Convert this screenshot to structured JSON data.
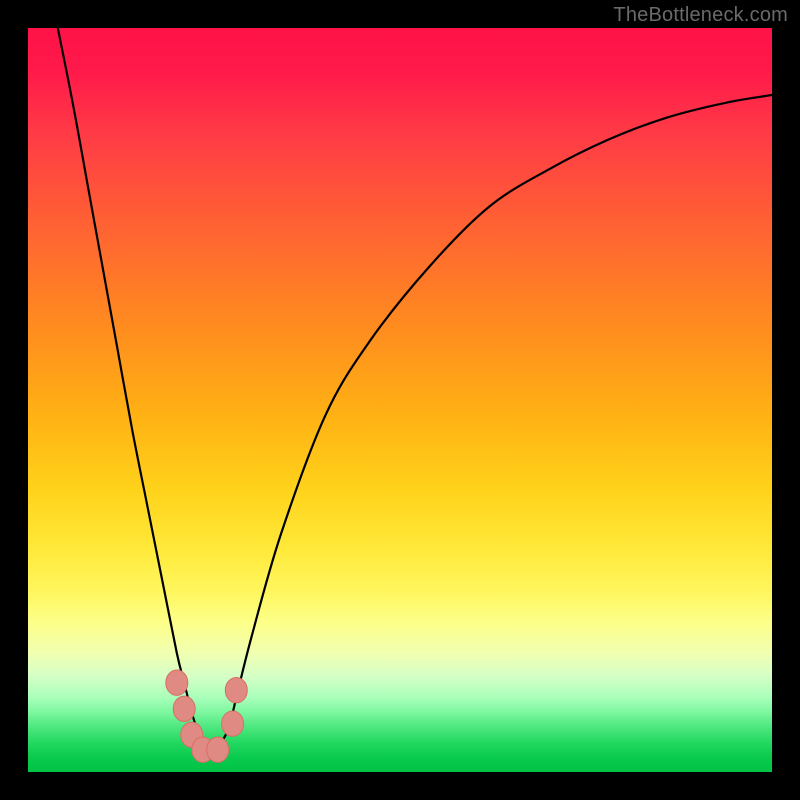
{
  "attribution": "TheBottleneck.com",
  "colors": {
    "curve_stroke": "#000000",
    "dot_fill": "#e08a84",
    "dot_stroke": "#d96e66",
    "background": "#000000"
  },
  "chart_data": {
    "type": "line",
    "title": "",
    "xlabel": "",
    "ylabel": "",
    "xlim": [
      0,
      100
    ],
    "ylim": [
      0,
      100
    ],
    "note": "Values are approximate percentages read from the plot. X is horizontal position across the gradient area (0=left, 100=right). Y is vertical height of the black curve above the bottom (0=bottom, 100=top). The curve forms a sharp V with its minimum near x≈24.",
    "series": [
      {
        "name": "bottleneck-curve",
        "x": [
          4,
          6,
          8,
          10,
          12,
          14,
          16,
          18,
          20,
          21,
          22,
          23,
          24,
          25,
          26,
          27,
          28,
          30,
          34,
          40,
          46,
          54,
          62,
          70,
          78,
          86,
          94,
          100
        ],
        "y": [
          100,
          90,
          79,
          68,
          57,
          46,
          36,
          26,
          16,
          12,
          8,
          5,
          3,
          3,
          4,
          6,
          10,
          18,
          32,
          48,
          58,
          68,
          76,
          81,
          85,
          88,
          90,
          91
        ]
      }
    ],
    "markers": {
      "name": "highlight-dots",
      "note": "Cluster of soft red dots near the curve minimum.",
      "points": [
        {
          "x": 20.0,
          "y": 12.0
        },
        {
          "x": 21.0,
          "y": 8.5
        },
        {
          "x": 22.0,
          "y": 5.0
        },
        {
          "x": 23.5,
          "y": 3.0
        },
        {
          "x": 25.5,
          "y": 3.0
        },
        {
          "x": 27.5,
          "y": 6.5
        },
        {
          "x": 28.0,
          "y": 11.0
        }
      ]
    },
    "gradient_stops": [
      {
        "pct": 0,
        "color": "#ff1248"
      },
      {
        "pct": 26,
        "color": "#ff6034"
      },
      {
        "pct": 52,
        "color": "#ffb114"
      },
      {
        "pct": 76,
        "color": "#fcff8a"
      },
      {
        "pct": 90,
        "color": "#a9ffba"
      },
      {
        "pct": 100,
        "color": "#00c244"
      }
    ]
  }
}
